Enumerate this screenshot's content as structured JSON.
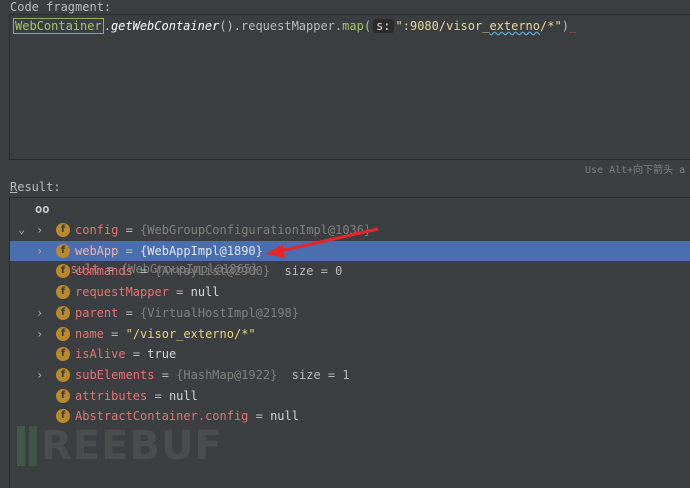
{
  "code_fragment": {
    "label": "Code fragment:",
    "class_name": "WebContainer",
    "method": "getWebContainer",
    "parens": "()",
    "field": ".requestMapper.",
    "call": "map",
    "param_hint": "s:",
    "string_prefix": "\":9080/visor_",
    "string_squiggly": "externo",
    "string_suffix": "/*\"",
    "close": ")",
    "hint_text": "Use Alt+向下箭头 a"
  },
  "result": {
    "label_first": "R",
    "label_rest": "esult:",
    "root": {
      "name": "result",
      "value": "{WebGroupImpl@1865}"
    },
    "items": [
      {
        "name": "config",
        "value": "{WebGroupConfigurationImpl@1036}",
        "expandable": true
      },
      {
        "name": "webApp",
        "value": "{WebAppImpl@1890}",
        "expandable": true,
        "selected": true
      },
      {
        "name": "commands",
        "value": "{ArrayList@2900}",
        "extra": "size = 0",
        "expandable": false
      },
      {
        "name": "requestMapper",
        "value": "null",
        "expandable": false
      },
      {
        "name": "parent",
        "value": "{VirtualHostImpl@2198}",
        "expandable": true
      },
      {
        "name": "name",
        "value": "\"/visor_externo/*\"",
        "expandable": true
      },
      {
        "name": "isAlive",
        "value": "true",
        "expandable": false
      },
      {
        "name": "subElements",
        "value": "{HashMap@1922}",
        "extra": "size = 1",
        "expandable": true
      },
      {
        "name": "attributes",
        "value": "null",
        "expandable": false
      },
      {
        "name": "AbstractContainer.config",
        "value": "null",
        "expandable": false
      }
    ]
  },
  "watermark": "REEBUF",
  "colors": {
    "selection": "#4b6eaf",
    "arrow": "#e8262a",
    "field_icon": "#b88a2a"
  }
}
